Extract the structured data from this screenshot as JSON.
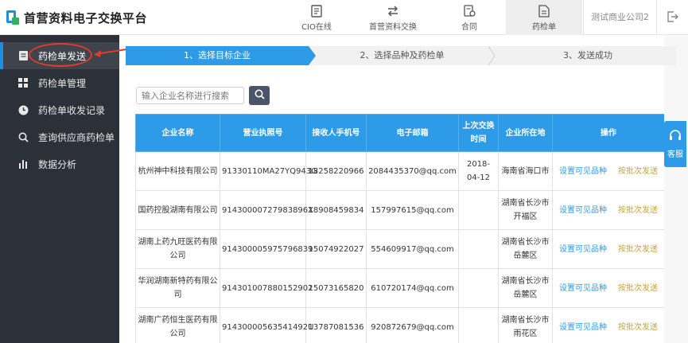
{
  "brand": {
    "name": "首营资料电子交换平台"
  },
  "nav": [
    {
      "label": "CIO在线",
      "icon": "document-icon",
      "active": false
    },
    {
      "label": "首营资料交换",
      "icon": "exchange-icon",
      "active": false
    },
    {
      "label": "合同",
      "icon": "contract-icon",
      "active": false
    },
    {
      "label": "药检单",
      "icon": "report-icon",
      "active": true
    }
  ],
  "user": {
    "company": "测试商业公司2"
  },
  "sidebar": {
    "items": [
      {
        "label": "药检单发送",
        "icon": "send-doc-icon",
        "active": true
      },
      {
        "label": "药检单管理",
        "icon": "grid-icon",
        "active": false
      },
      {
        "label": "药检单收发记录",
        "icon": "clock-icon",
        "active": false
      },
      {
        "label": "查询供应商药检单",
        "icon": "search-icon",
        "active": false
      },
      {
        "label": "数据分析",
        "icon": "bar-chart-icon",
        "active": false
      }
    ]
  },
  "steps": [
    "1、选择目标企业",
    "2、选择品种及药检单",
    "3、发送成功"
  ],
  "search": {
    "placeholder": "输入企业名称进行搜索",
    "value": ""
  },
  "table": {
    "headers": [
      "企业名称",
      "营业执照号",
      "接收人手机号",
      "电子邮箱",
      "上次交换时间",
      "企业所在地",
      "操作"
    ],
    "actions": {
      "set_visible": "设置可见品种",
      "batch_send": "按批次发送"
    },
    "rows": [
      {
        "name": "杭州神中科技有限公司",
        "license": "91330110MA27YQ943G",
        "phone": "18258220966",
        "email": "2084435370@qq.com",
        "last": "2018-04-12",
        "location": "海南省海口市"
      },
      {
        "name": "国药控股湖南有限公司",
        "license": "91430000727983896X",
        "phone": "18908459834",
        "email": "157997615@qq.com",
        "last": "",
        "location": "湖南省长沙市开福区"
      },
      {
        "name": "湖南上药九旺医药有限公司",
        "license": "914300005975796839",
        "phone": "15074922027",
        "email": "554609917@qq.com",
        "last": "",
        "location": "湖南省长沙市岳麓区"
      },
      {
        "name": "华润湖南新特药有限公司",
        "license": "914301007880152902",
        "phone": "15073165820",
        "email": "610720174@qq.com",
        "last": "",
        "location": "湖南省长沙市岳麓区"
      },
      {
        "name": "湖南广药恒生医药有限公司",
        "license": "91430000563541492U",
        "phone": "13787081536",
        "email": "920872679@qq.com",
        "last": "",
        "location": "湖南省长沙市雨花区"
      }
    ]
  },
  "service": {
    "label": "客服"
  },
  "colors": {
    "accent": "#2d9be8",
    "sidebar": "#2c3038",
    "highlight": "#e23b2e",
    "batch": "#c7a13a"
  }
}
